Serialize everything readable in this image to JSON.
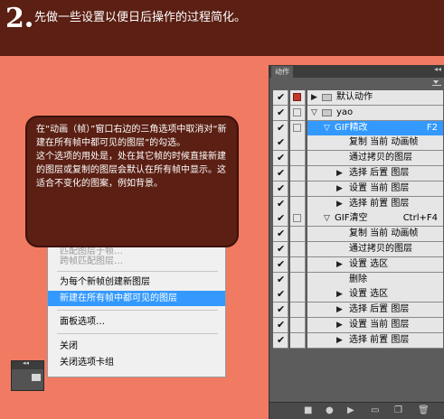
{
  "header": {
    "step_number": "2",
    "step_text": "先做一些设置以便日后操作的过程简化。"
  },
  "callout": {
    "paragraph1": "在“动画（帧）”窗口右边的三角选项中取消对“新建在所有帧中都可见的图层”的勾选。",
    "paragraph2": "这个选项的用处是，处在其它帧的时候直接新建的图层或复制的图层会默认在所有帧中显示。这适合不变化的图案，例如背景。"
  },
  "context_menu": {
    "items": [
      {
        "label": "匹配图层于帧…",
        "disabled": true
      },
      {
        "label": "跨帧匹配图层…",
        "disabled": true
      },
      {
        "label": "为每个新帧创建新图层",
        "disabled": false
      },
      {
        "label": "新建在所有帧中都可见的图层",
        "disabled": false,
        "selected": true
      },
      {
        "label": "面板选项…",
        "disabled": false
      },
      {
        "label": "关闭",
        "disabled": false
      },
      {
        "label": "关闭选项卡组",
        "disabled": false
      }
    ]
  },
  "actions_panel": {
    "tab_label": "动作",
    "collapse_glyph": "◂◂",
    "footer_buttons": [
      "stop-icon",
      "record-icon",
      "play-icon",
      "new-set-icon",
      "new-action-icon",
      "delete-icon"
    ],
    "rows": [
      {
        "type": "set",
        "label": "默认动作",
        "expanded": false,
        "checked": true
      },
      {
        "type": "set",
        "label": "yao",
        "expanded": true,
        "checked": true
      },
      {
        "type": "action",
        "label": "GIF精改",
        "shortcut": "F2",
        "expanded": true,
        "checked": true,
        "selected": true
      },
      {
        "type": "step",
        "label": "复制 当前 动画帧",
        "expandable": false,
        "checked": true
      },
      {
        "type": "step",
        "label": "通过拷贝的图层",
        "expandable": false,
        "checked": true
      },
      {
        "type": "step",
        "label": "选择 后置 图层",
        "expandable": true,
        "checked": true
      },
      {
        "type": "step",
        "label": "设置 当前 图层",
        "expandable": true,
        "checked": true
      },
      {
        "type": "step",
        "label": "选择 前置 图层",
        "expandable": true,
        "checked": true
      },
      {
        "type": "action",
        "label": "GIF清空",
        "shortcut": "Ctrl+F4",
        "expanded": true,
        "checked": true,
        "selected": false
      },
      {
        "type": "step",
        "label": "复制 当前 动画帧",
        "expandable": false,
        "checked": true
      },
      {
        "type": "step",
        "label": "通过拷贝的图层",
        "expandable": false,
        "checked": true
      },
      {
        "type": "step",
        "label": "设置 选区",
        "expandable": true,
        "checked": true
      },
      {
        "type": "step",
        "label": "删除",
        "expandable": false,
        "checked": true
      },
      {
        "type": "step",
        "label": "设置 选区",
        "expandable": true,
        "checked": true
      },
      {
        "type": "step",
        "label": "选择 后置 图层",
        "expandable": true,
        "checked": true
      },
      {
        "type": "step",
        "label": "设置 当前 图层",
        "expandable": true,
        "checked": true
      },
      {
        "type": "step",
        "label": "选择 前置 图层",
        "expandable": true,
        "checked": true
      }
    ]
  },
  "mini_panel": {
    "collapse_glyph": "◂◂"
  }
}
